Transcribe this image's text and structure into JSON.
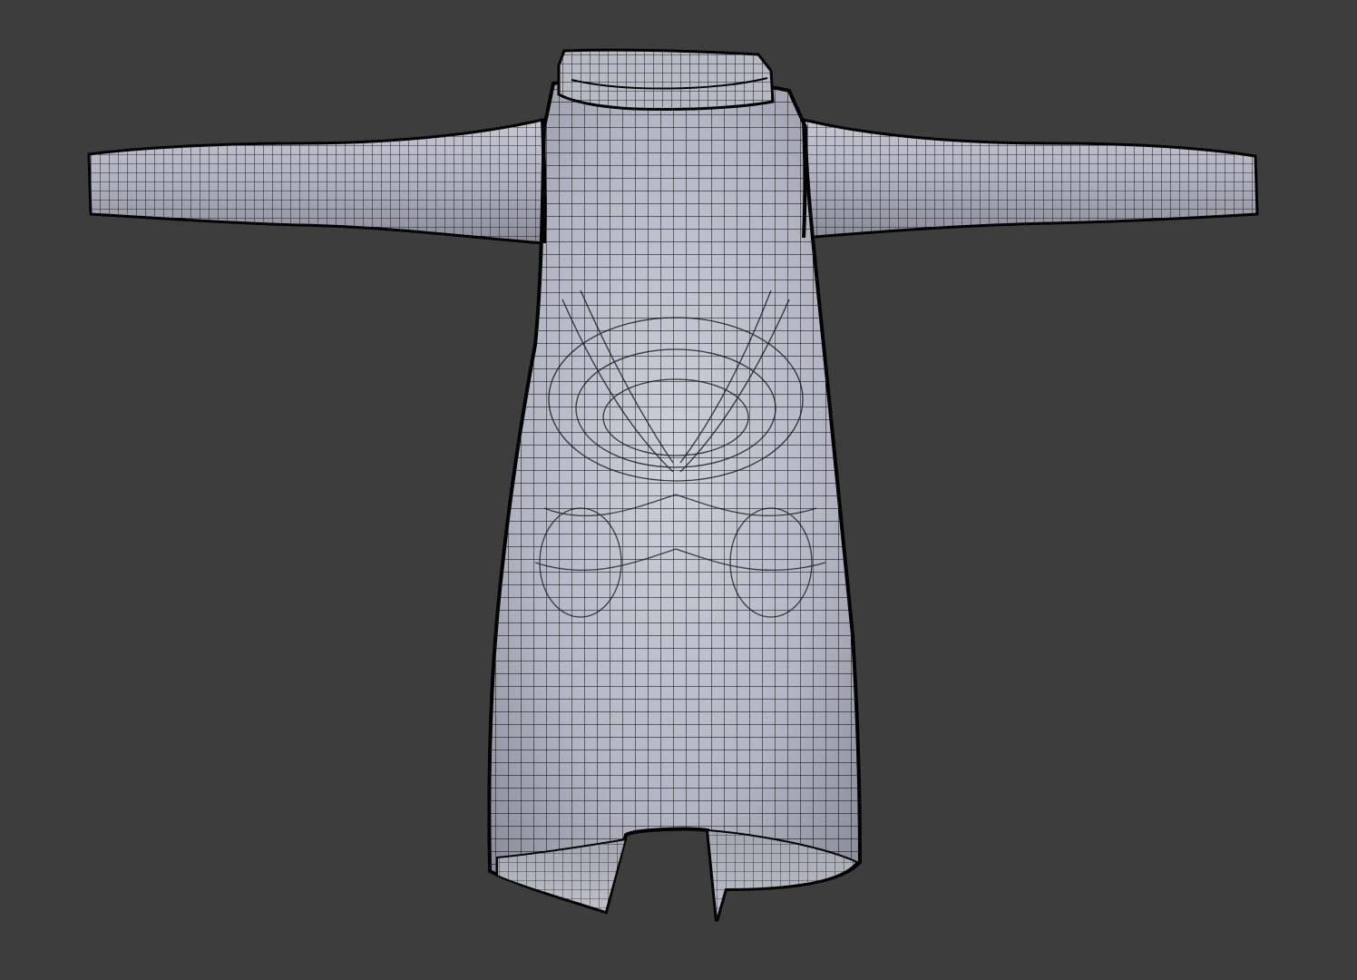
{
  "viewport": {
    "background": "#3d3d3d",
    "object": {
      "name": "dress-mesh",
      "type": "garment",
      "shading": "solid-wireframe",
      "colors": {
        "surface_light": "#c9c9d6",
        "surface_mid": "#a9a9b8",
        "surface_dark": "#7d7d8c",
        "wire": "#111111",
        "outline": "#000000"
      }
    }
  }
}
